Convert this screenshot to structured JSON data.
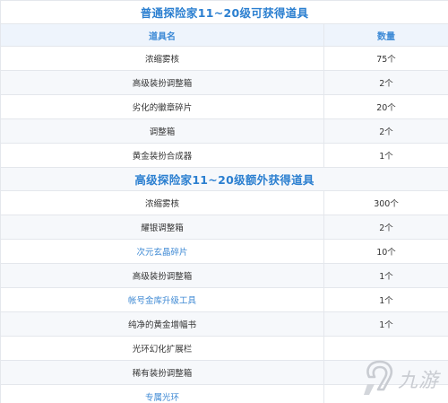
{
  "section1": {
    "title": "普通探险家11~20级可获得道具",
    "header": {
      "name": "道具名",
      "qty": "数量"
    },
    "items": [
      {
        "name": "浓缩雾核",
        "qty": "75个"
      },
      {
        "name": "高级装扮调整箱",
        "qty": "2个"
      },
      {
        "name": "劣化的徽章碎片",
        "qty": "20个"
      },
      {
        "name": "调整箱",
        "qty": "2个"
      },
      {
        "name": "黄金装扮合成器",
        "qty": "1个"
      }
    ]
  },
  "section2": {
    "title": "高级探险家11~20级额外获得道具",
    "items": [
      {
        "name": "浓缩雾核",
        "qty": "300个"
      },
      {
        "name": "耀银调整箱",
        "qty": "2个"
      },
      {
        "name": "次元玄晶碎片",
        "qty": "10个"
      },
      {
        "name": "高级装扮调整箱",
        "qty": "1个"
      },
      {
        "name": "帐号金库升级工具",
        "qty": "1个"
      },
      {
        "name": "纯净的黄金增幅书",
        "qty": "1个"
      },
      {
        "name": "光环幻化扩展栏",
        "qty": ""
      },
      {
        "name": "稀有装扮调整箱",
        "qty": ""
      },
      {
        "name": "专属光环",
        "qty": ""
      }
    ]
  },
  "watermark": {
    "text": "九游",
    "icon": "jiuyou-logo-icon",
    "color": "#c9ccd2"
  },
  "colors": {
    "title": "#2b7fd0",
    "header_bg": "#eef4fc",
    "link": "#3f8ad4",
    "border": "#e4e7ec"
  }
}
